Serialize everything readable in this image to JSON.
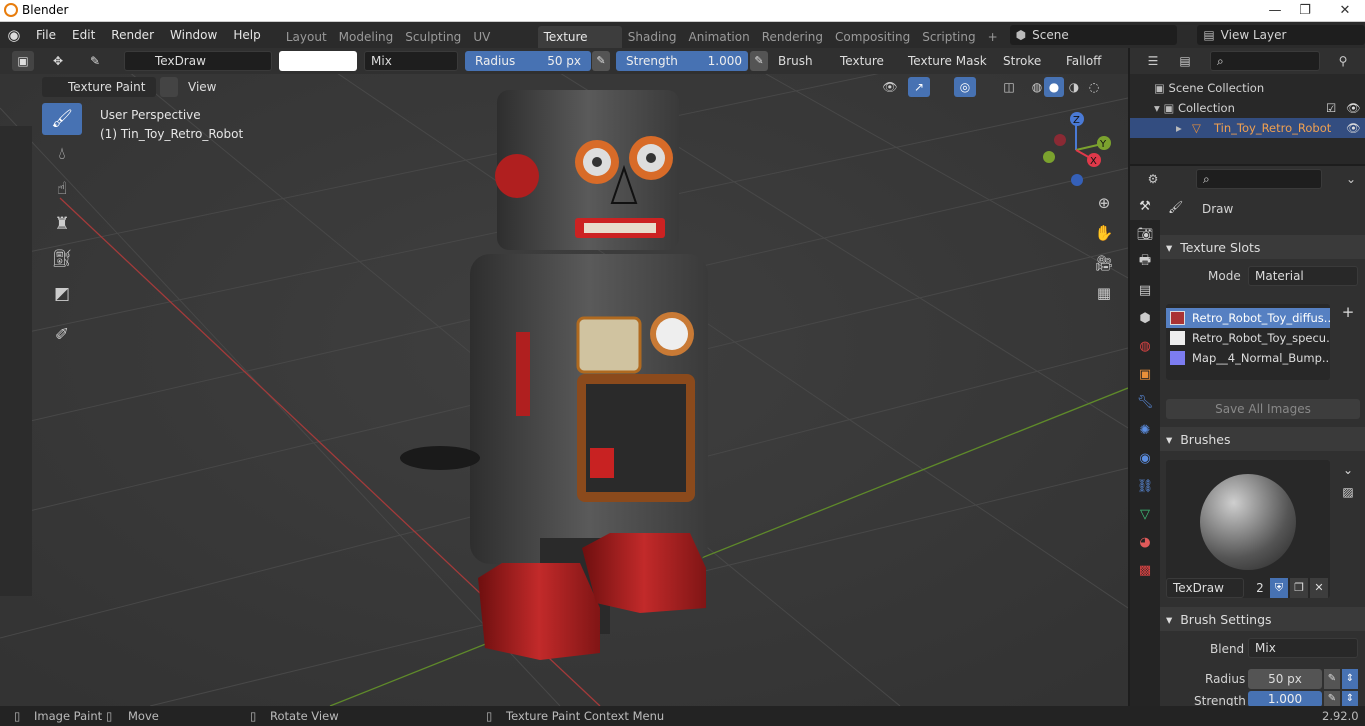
{
  "window": {
    "title": "Blender"
  },
  "menus": [
    "File",
    "Edit",
    "Render",
    "Window",
    "Help"
  ],
  "workspaces": {
    "tabs": [
      "Layout",
      "Modeling",
      "Sculpting",
      "UV Editing",
      "Texture Paint",
      "Shading",
      "Animation",
      "Rendering",
      "Compositing",
      "Scripting"
    ],
    "active": "Texture Paint",
    "add": "+"
  },
  "scene": {
    "name": "Scene",
    "view_layer": "View Layer"
  },
  "toolbar": {
    "brush_name": "TexDraw",
    "blend": "Mix",
    "radius_label": "Radius",
    "radius_value": "50 px",
    "strength_label": "Strength",
    "strength_value": "1.000",
    "strength_fraction": 1.0,
    "dropdowns": [
      "Brush",
      "Texture",
      "Texture Mask",
      "Stroke",
      "Falloff"
    ]
  },
  "viewport_header": {
    "mode": "Texture Paint",
    "view": "View"
  },
  "viewport": {
    "perspective": "User Perspective",
    "object": "(1) Tin_Toy_Retro_Robot",
    "gizmo": {
      "z": "Z",
      "y": "Y",
      "x": "X"
    }
  },
  "outliner": {
    "root": "Scene Collection",
    "collection": "Collection",
    "object": "Tin_Toy_Retro_Robot"
  },
  "properties": {
    "tool_name": "Draw",
    "texture_slots": {
      "header": "Texture Slots",
      "mode_label": "Mode",
      "mode_value": "Material",
      "slots": [
        "Retro_Robot_Toy_diffus...",
        "Retro_Robot_Toy_specu...",
        "Map__4_Normal_Bump..."
      ],
      "save_all": "Save All Images"
    },
    "brushes": {
      "header": "Brushes",
      "brush_name": "TexDraw",
      "users": "2"
    },
    "brush_settings": {
      "header": "Brush Settings",
      "blend_label": "Blend",
      "blend_value": "Mix",
      "radius_label": "Radius",
      "radius_value": "50 px",
      "strength_label": "Strength",
      "strength_value": "1.000"
    }
  },
  "statusbar": {
    "items": [
      "Image Paint",
      "Move",
      "Rotate View",
      "Texture Paint Context Menu"
    ],
    "version": "2.92.0"
  },
  "colors": {
    "accent": "#4772b3",
    "selected": "#5680c2",
    "red_axis": "#a33a3a",
    "green_axis": "#5f8a2a"
  }
}
